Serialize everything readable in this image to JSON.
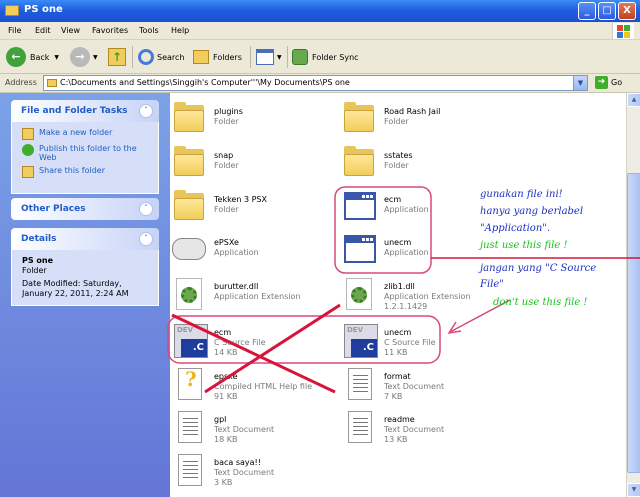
{
  "window": {
    "title": "PS one"
  },
  "titlebar_buttons": [
    "_",
    "□",
    "X"
  ],
  "menu": [
    "File",
    "Edit",
    "View",
    "Favorites",
    "Tools",
    "Help"
  ],
  "toolbar": {
    "back_label": "Back",
    "search_label": "Search",
    "folders_label": "Folders",
    "folder_sync_label": "Folder Sync"
  },
  "address": {
    "label": "Address",
    "path": "C:\\Documents and Settings\\Singgih's Computer'''\\My Documents\\PS one",
    "go_label": "Go"
  },
  "left_pane": {
    "file_tasks": {
      "title": "File and Folder Tasks",
      "items": [
        "Make a new folder",
        "Publish this folder to the Web",
        "Share this folder"
      ]
    },
    "other_places": {
      "title": "Other Places"
    },
    "details": {
      "title": "Details",
      "name": "PS one",
      "type": "Folder",
      "modified": "Date Modified: Saturday, January 22, 2011, 2:24 AM"
    }
  },
  "files": [
    {
      "name": "plugins",
      "type": "Folder",
      "size": "",
      "icon": "folder-icon"
    },
    {
      "name": "Road Rash Jail",
      "type": "Folder",
      "size": "",
      "icon": "folder-icon"
    },
    {
      "name": "snap",
      "type": "Folder",
      "size": "",
      "icon": "folder-icon"
    },
    {
      "name": "sstates",
      "type": "Folder",
      "size": "",
      "icon": "folder-icon"
    },
    {
      "name": "Tekken 3 PSX",
      "type": "Folder",
      "size": "",
      "icon": "folder-icon"
    },
    {
      "name": "ecm",
      "type": "Application",
      "size": "",
      "icon": "application-icon"
    },
    {
      "name": "ePSXe",
      "type": "Application",
      "size": "",
      "icon": "gamepad-icon"
    },
    {
      "name": "unecm",
      "type": "Application",
      "size": "",
      "icon": "application-icon"
    },
    {
      "name": "burutter.dll",
      "type": "Application Extension",
      "size": "",
      "icon": "dll-icon"
    },
    {
      "name": "zlib1.dll",
      "type": "Application Extension",
      "size": "1.2.1.1429",
      "icon": "dll-icon"
    },
    {
      "name": "ecm",
      "type": "C Source File",
      "size": "14 KB",
      "icon": "c-source-icon"
    },
    {
      "name": "unecm",
      "type": "C Source File",
      "size": "11 KB",
      "icon": "c-source-icon"
    },
    {
      "name": "epsxe",
      "type": "Compiled HTML Help file",
      "size": "91 KB",
      "icon": "help-file-icon"
    },
    {
      "name": "format",
      "type": "Text Document",
      "size": "7 KB",
      "icon": "text-document-icon"
    },
    {
      "name": "gpl",
      "type": "Text Document",
      "size": "18 KB",
      "icon": "text-document-icon"
    },
    {
      "name": "readme",
      "type": "Text Document",
      "size": "13 KB",
      "icon": "text-document-icon"
    },
    {
      "name": "baca saya!!",
      "type": "Text Document",
      "size": "3 KB",
      "icon": "text-document-icon"
    }
  ],
  "annotations": {
    "blue_lines": [
      "gunakan file ini!",
      "hanya yang berlabel",
      "\"Application\"."
    ],
    "green_1": "just use this file !",
    "blue_lines_2": [
      "jangan yang \"C Source",
      "File\""
    ],
    "green_2": "don't use this file !"
  },
  "colors": {
    "titlebar": "#1f5fe0",
    "left_pane": "#6d8ee0",
    "annotation_blue": "#1a2fc0",
    "annotation_green": "#19c21a",
    "annotation_red": "#d9143a",
    "highlight_pink": "#d94a7a"
  }
}
